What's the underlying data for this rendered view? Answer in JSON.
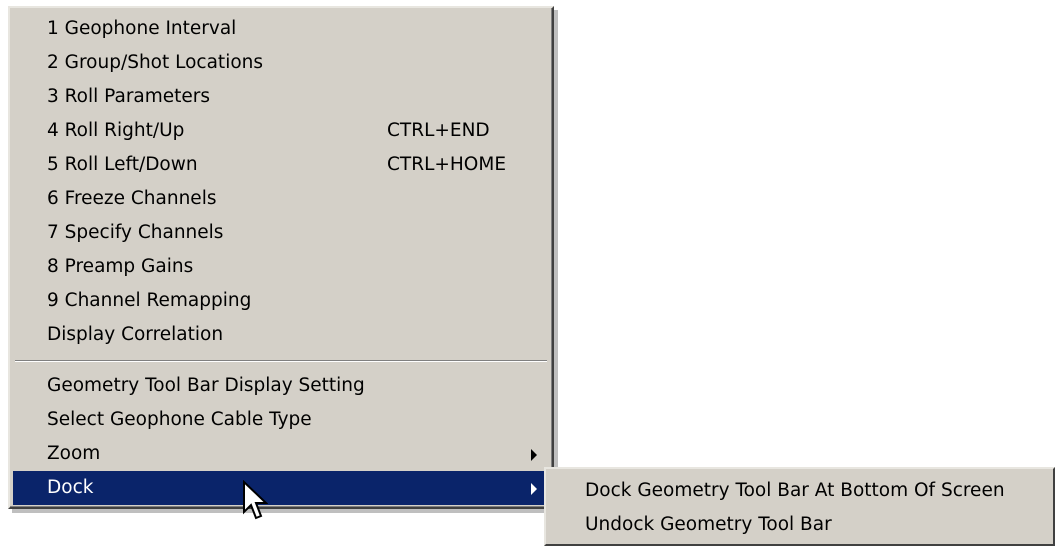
{
  "menu": {
    "items": [
      {
        "label": "1 Geophone Interval"
      },
      {
        "label": "2 Group/Shot Locations"
      },
      {
        "label": "3 Roll Parameters"
      },
      {
        "label": "4 Roll Right/Up",
        "shortcut": "CTRL+END"
      },
      {
        "label": "5 Roll Left/Down",
        "shortcut": "CTRL+HOME"
      },
      {
        "label": "6 Freeze Channels"
      },
      {
        "label": "7 Specify Channels"
      },
      {
        "label": "8 Preamp Gains"
      },
      {
        "label": "9 Channel Remapping"
      },
      {
        "label": "Display Correlation"
      }
    ],
    "items2": [
      {
        "label": "Geometry Tool Bar Display Setting"
      },
      {
        "label": "Select Geophone Cable Type"
      },
      {
        "label": "Zoom"
      },
      {
        "label": "Dock"
      }
    ]
  },
  "submenu": {
    "items": [
      {
        "label": "Dock Geometry Tool Bar At Bottom Of Screen"
      },
      {
        "label": "Undock Geometry Tool Bar"
      }
    ]
  },
  "colors": {
    "menu_bg": "#d4d0c8",
    "highlight_bg": "#0a246a",
    "highlight_text": "#ffffff"
  },
  "icons": {
    "submenu_arrow": "right-triangle",
    "cursor": "arrow-pointer"
  }
}
